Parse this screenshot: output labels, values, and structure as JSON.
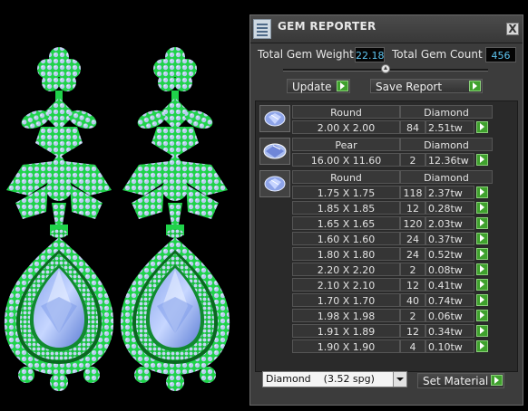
{
  "panel": {
    "title": "GEM REPORTER",
    "close_glyph": "X",
    "icon": "gem-reporter-icon"
  },
  "summary": {
    "weight_label": "Total Gem Weight",
    "weight_value": "22.18",
    "count_label": "Total Gem Count",
    "count_value": "456"
  },
  "slider": {
    "position_fraction": 0.5
  },
  "buttons": {
    "update_label": "Update",
    "save_report_label": "Save Report",
    "set_material_label": "Set Material"
  },
  "material_select": {
    "selected": "Diamond    (3.52 spg)"
  },
  "groups": [
    {
      "shape": "Round",
      "material": "Diamond",
      "rows": [
        {
          "size": "2.00 X 2.00",
          "count": "84",
          "weight": "2.51tw"
        }
      ]
    },
    {
      "shape": "Pear",
      "material": "Diamond",
      "rows": [
        {
          "size": "16.00 X 11.60",
          "count": "2",
          "weight": "12.36tw"
        }
      ]
    },
    {
      "shape": "Round",
      "material": "Diamond",
      "rows": [
        {
          "size": "1.75 X 1.75",
          "count": "118",
          "weight": "2.37tw"
        },
        {
          "size": "1.85 X 1.85",
          "count": "12",
          "weight": "0.28tw"
        },
        {
          "size": "1.65 X 1.65",
          "count": "120",
          "weight": "2.03tw"
        },
        {
          "size": "1.60 X 1.60",
          "count": "24",
          "weight": "0.37tw"
        },
        {
          "size": "1.80 X 1.80",
          "count": "24",
          "weight": "0.52tw"
        },
        {
          "size": "2.20 X 2.20",
          "count": "2",
          "weight": "0.08tw"
        },
        {
          "size": "2.10 X 2.10",
          "count": "12",
          "weight": "0.41tw"
        },
        {
          "size": "1.70 X 1.70",
          "count": "40",
          "weight": "0.74tw"
        },
        {
          "size": "1.98 X 1.98",
          "count": "2",
          "weight": "0.06tw"
        },
        {
          "size": "1.91 X 1.89",
          "count": "12",
          "weight": "0.34tw"
        },
        {
          "size": "1.90 X 1.90",
          "count": "4",
          "weight": "0.10tw"
        }
      ]
    }
  ],
  "colors": {
    "metal_green": "#1fd34a",
    "gem_blue": "#b9cdf0",
    "value_blue": "#5ec6f2",
    "button_green": "#3fa12d"
  }
}
